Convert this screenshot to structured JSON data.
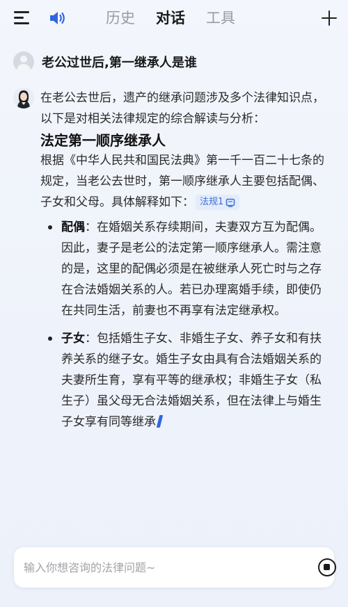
{
  "header": {
    "tabs": [
      {
        "label": "历史"
      },
      {
        "label": "对话"
      },
      {
        "label": "工具"
      }
    ],
    "active_tab": "对话"
  },
  "chat": {
    "question": "老公过世后,第一继承人是谁",
    "answer": {
      "intro": "在老公去世后，遗产的继承问题涉及多个法律知识点，以下是对相关法律规定的综合解读与分析：",
      "heading": "法定第一顺序继承人",
      "paragraph": "根据《中华人民共和国民法典》第一千一百二十七条的规定，当老公去世时，第一顺序继承人主要包括配偶、子女和父母。具体解释如下：",
      "law_tag": "法规1",
      "bullets": [
        {
          "term": "配偶",
          "text": "：在婚姻关系存续期间，夫妻双方互为配偶。因此，妻子是老公的法定第一顺序继承人。需注意的是，这里的配偶必须是在被继承人死亡时与之存在合法婚姻关系的人。若已办理离婚手续，即使仍在共同生活，前妻也不再享有法定继承权。"
        },
        {
          "term": "子女",
          "text": "：包括婚生子女、非婚生子女、养子女和有扶养关系的继子女。婚生子女由具有合法婚姻关系的夫妻所生育，享有平等的继承权；非婚生子女（私生子）虽父母无合法婚姻关系，但在法律上与婚生子女享有同等继承"
        }
      ]
    }
  },
  "input": {
    "placeholder": "输入你想咨询的法律问题~",
    "value": ""
  },
  "colors": {
    "accent": "#2f66e0",
    "tag_bg": "#e4ecfb",
    "tag_text": "#3b6fd9"
  }
}
